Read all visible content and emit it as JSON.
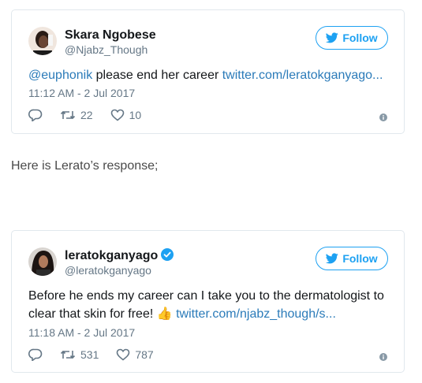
{
  "tweet1": {
    "name": "Skara Ngobese",
    "handle": "@Njabz_Though",
    "follow_label": "Follow",
    "mention": "@euphonik",
    "text": " please end her career ",
    "link": "twitter.com/leratokganyago...",
    "time": "11:12 AM - 2 Jul 2017",
    "retweets": "22",
    "likes": "10"
  },
  "between_text": "Here is Lerato’s response;",
  "tweet2": {
    "name": "leratokganyago",
    "handle": "@leratokganyago",
    "follow_label": "Follow",
    "text_line1": "Before he ends my career can I take you to the dermatologist to",
    "text_line2": "clear that skin for free! ",
    "emoji": "👍",
    "link": "twitter.com/njabz_though/s...",
    "time": "11:18 AM - 2 Jul 2017",
    "retweets": "531",
    "likes": "787"
  },
  "colors": {
    "brand": "#1da1f2",
    "link": "#2b7bb9",
    "muted": "#657786"
  }
}
